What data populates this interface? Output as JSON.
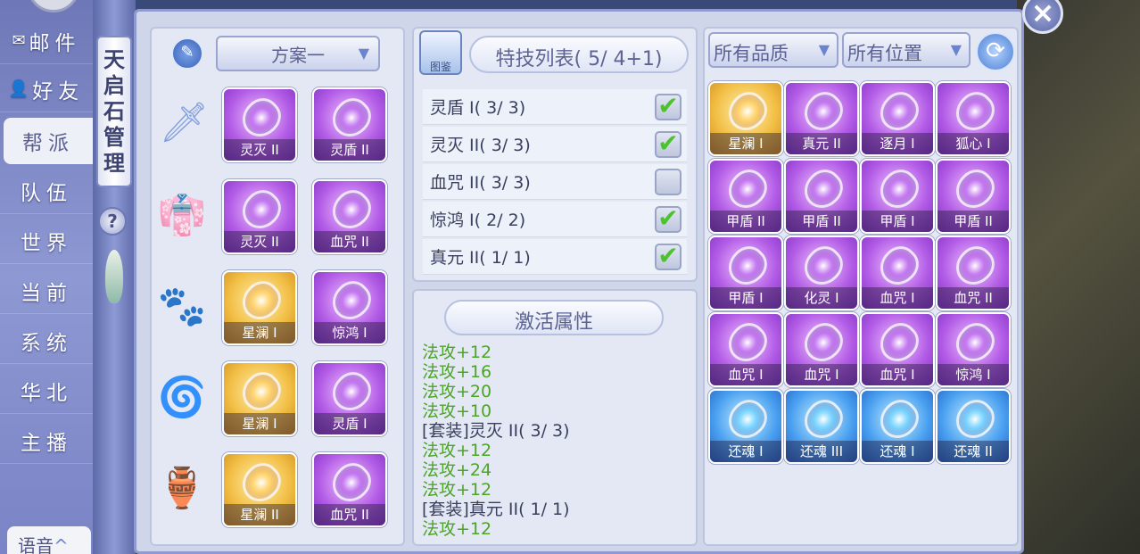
{
  "chat": {
    "top_items": [
      {
        "icon": "mail-icon",
        "glyph": "✉",
        "label": "邮件"
      },
      {
        "icon": "friend-icon",
        "glyph": "👤",
        "label": "好友"
      }
    ],
    "channels": [
      "帮派",
      "队伍",
      "世界",
      "当前",
      "系统",
      "华北",
      "主播"
    ],
    "active_channel": "帮派",
    "voice_label": "语音"
  },
  "window": {
    "title_chars": [
      "天",
      "启",
      "石",
      "管",
      "理"
    ],
    "help": "?",
    "close": "×"
  },
  "plan": {
    "selected": "方案一",
    "positions": [
      {
        "icon": "weapon-icon",
        "glyph": "🗡",
        "slots": [
          {
            "name": "灵灭 II",
            "color": "purple"
          },
          {
            "name": "灵盾 II",
            "color": "purple"
          }
        ]
      },
      {
        "icon": "armor-icon",
        "glyph": "👘",
        "slots": [
          {
            "name": "灵灭 II",
            "color": "purple"
          },
          {
            "name": "血咒 II",
            "color": "purple"
          }
        ]
      },
      {
        "icon": "boots-icon",
        "glyph": "🐾",
        "slots": [
          {
            "name": "星澜 I",
            "color": "gold"
          },
          {
            "name": "惊鸿 I",
            "color": "purple"
          }
        ]
      },
      {
        "icon": "helmet-icon",
        "glyph": "🌀",
        "slots": [
          {
            "name": "星澜 I",
            "color": "gold"
          },
          {
            "name": "灵盾 I",
            "color": "purple"
          }
        ]
      },
      {
        "icon": "necklace-icon",
        "glyph": "🏺",
        "slots": [
          {
            "name": "星澜 II",
            "color": "gold"
          },
          {
            "name": "血咒 II",
            "color": "purple"
          }
        ]
      }
    ]
  },
  "skills": {
    "book_label": "图鉴",
    "title": "特技列表( 5/ 4+1)",
    "rows": [
      {
        "label": "灵盾 I( 3/ 3)",
        "checked": true
      },
      {
        "label": "灵灭 II( 3/ 3)",
        "checked": true
      },
      {
        "label": "血咒 II( 3/ 3)",
        "checked": false
      },
      {
        "label": "惊鸿 I( 2/ 2)",
        "checked": true
      },
      {
        "label": "真元 II( 1/ 1)",
        "checked": true
      }
    ]
  },
  "attributes": {
    "title": "激活属性",
    "lines": [
      {
        "text": "法攻+12",
        "style": "green"
      },
      {
        "text": "法攻+16",
        "style": "green"
      },
      {
        "text": "法攻+20",
        "style": "green"
      },
      {
        "text": "法攻+10",
        "style": "green"
      },
      {
        "text": "[套装]灵灭 II( 3/ 3)",
        "style": "dark"
      },
      {
        "text": "法攻+12",
        "style": "green"
      },
      {
        "text": "法攻+24",
        "style": "green"
      },
      {
        "text": "法攻+12",
        "style": "green"
      },
      {
        "text": "[套装]真元 II( 1/ 1)",
        "style": "dark"
      },
      {
        "text": "法攻+12",
        "style": "green"
      }
    ]
  },
  "inventory": {
    "quality_filter": "所有品质",
    "position_filter": "所有位置",
    "items": [
      {
        "name": "星澜 I",
        "color": "gold"
      },
      {
        "name": "真元 II",
        "color": "purple"
      },
      {
        "name": "逐月 I",
        "color": "purple"
      },
      {
        "name": "狐心 I",
        "color": "purple"
      },
      {
        "name": "甲盾 II",
        "color": "purple"
      },
      {
        "name": "甲盾 II",
        "color": "purple"
      },
      {
        "name": "甲盾 I",
        "color": "purple"
      },
      {
        "name": "甲盾 II",
        "color": "purple"
      },
      {
        "name": "甲盾 I",
        "color": "purple"
      },
      {
        "name": "化灵 I",
        "color": "purple"
      },
      {
        "name": "血咒 I",
        "color": "purple"
      },
      {
        "name": "血咒 II",
        "color": "purple"
      },
      {
        "name": "血咒 I",
        "color": "purple"
      },
      {
        "name": "血咒 I",
        "color": "purple"
      },
      {
        "name": "血咒 I",
        "color": "purple"
      },
      {
        "name": "惊鸿 I",
        "color": "purple"
      },
      {
        "name": "还魂 I",
        "color": "blue"
      },
      {
        "name": "还魂 III",
        "color": "blue"
      },
      {
        "name": "还魂 I",
        "color": "blue"
      },
      {
        "name": "还魂 II",
        "color": "blue"
      }
    ]
  }
}
